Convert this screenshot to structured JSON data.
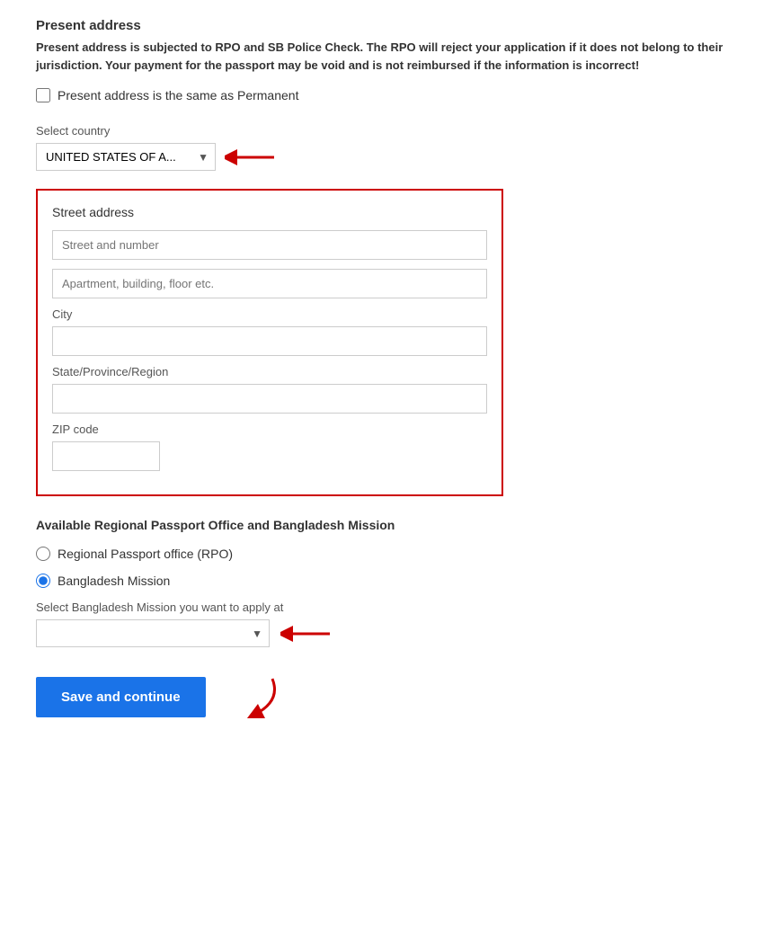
{
  "section": {
    "title": "Present address",
    "description": "Present address is subjected to RPO and SB Police Check. The RPO will reject your application if it does not belong to their jurisdiction. Your payment for the passport may be void and is not reimbursed if the information is incorrect!",
    "checkbox_label": "Present address is the same as Permanent",
    "country_label": "Select country",
    "country_value": "UNITED STATES OF A...",
    "street_address": {
      "box_title": "Street address",
      "street_placeholder": "Street and number",
      "apt_placeholder": "Apartment, building, floor etc.",
      "city_label": "City",
      "city_value": "",
      "state_label": "State/Province/Region",
      "state_value": "",
      "zip_label": "ZIP code",
      "zip_value": ""
    },
    "available_section_title": "Available Regional Passport Office and Bangladesh Mission",
    "radio_rpo": "Regional Passport office (RPO)",
    "radio_mission": "Bangladesh Mission",
    "mission_select_label": "Select Bangladesh Mission you want to apply at",
    "mission_select_value": "",
    "save_button": "Save and continue"
  }
}
